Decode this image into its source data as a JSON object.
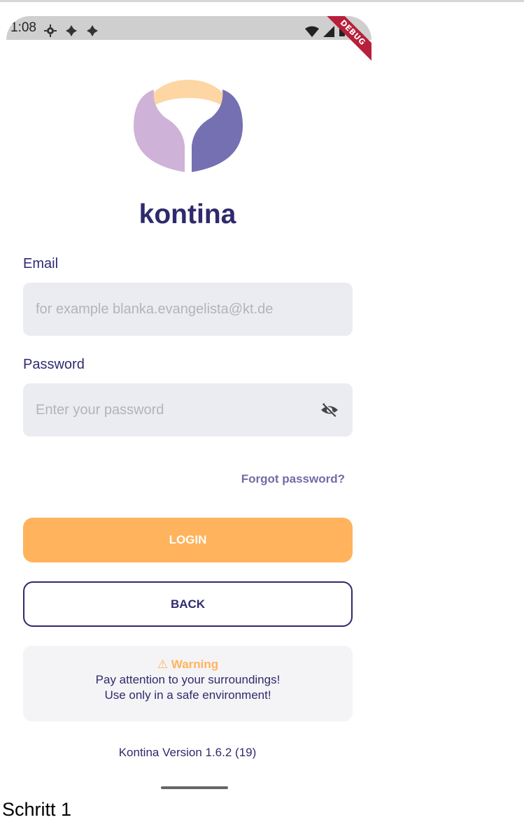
{
  "status_bar": {
    "time": "1:08",
    "left_icons": [
      "gear-icon",
      "notification-icon",
      "notification-icon"
    ],
    "right_icons": [
      "wifi-icon",
      "signal-icon",
      "battery-icon"
    ],
    "debug_label": "DEBUG"
  },
  "brand": {
    "logo_icon": "kontina-logo-icon",
    "title": "kontina",
    "colors": {
      "primary": "#2f2a6d",
      "accent": "#ffb35c",
      "logo_left": "#cfb2d7",
      "logo_right": "#7470b2",
      "logo_top": "#fdd6a4"
    }
  },
  "form": {
    "email": {
      "label": "Email",
      "placeholder": "for example blanka.evangelista@kt.de",
      "value": ""
    },
    "password": {
      "label": "Password",
      "placeholder": "Enter your password",
      "value": "",
      "visibility_icon": "eye-off-icon"
    },
    "forgot_password_label": "Forgot password?",
    "login_label": "LOGIN",
    "back_label": "BACK"
  },
  "warning": {
    "icon": "⚠",
    "title": "Warning",
    "line1": "Pay attention to your surroundings!",
    "line2": "Use only in a safe environment!"
  },
  "footer": {
    "version": "Kontina Version 1.6.2 (19)"
  },
  "caption": "Schritt 1"
}
